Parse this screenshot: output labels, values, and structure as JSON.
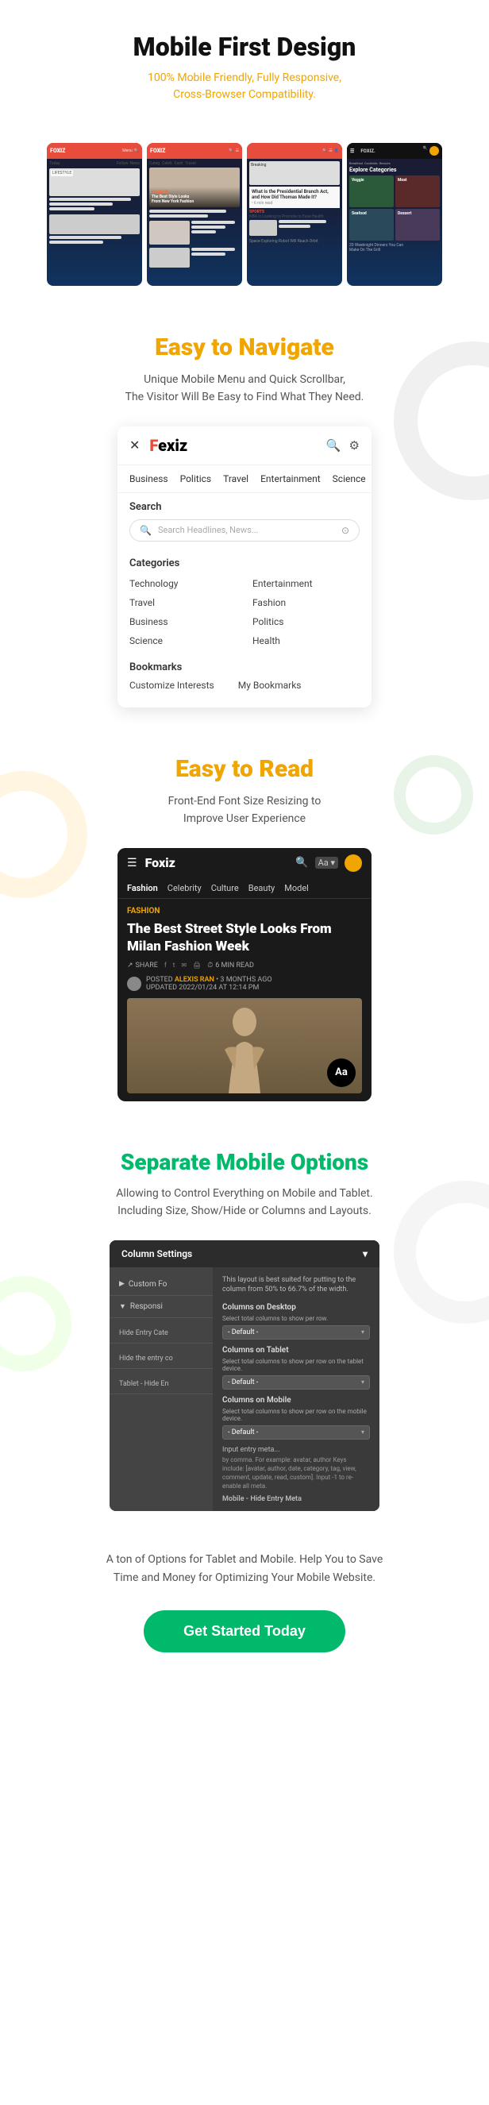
{
  "section1": {
    "title": "Mobile First Design",
    "subtitle": "100% Mobile Friendly, Fully Responsive,\nCross-Browser Compatibility."
  },
  "section2": {
    "title": "Easy to Navigate",
    "description": "Unique Mobile Menu and Quick Scrollbar,\nThe Visitor Will Be Easy to Find What They Need.",
    "menu": {
      "logo": "F",
      "logoRest": "exiz",
      "categories": [
        "Business",
        "Politics",
        "Travel",
        "Entertainment",
        "Science"
      ],
      "search_label": "Search",
      "search_placeholder": "Search Headlines, News...",
      "categories_label": "Categories",
      "cat_items": [
        {
          "col1": "Technology",
          "col2": "Entertainment"
        },
        {
          "col1": "Travel",
          "col2": "Fashion"
        },
        {
          "col1": "Business",
          "col2": "Politics"
        },
        {
          "col1": "Science",
          "col2": "Health"
        }
      ],
      "bookmarks_label": "Bookmarks",
      "bookmark_items": [
        "Customize Interests",
        "My Bookmarks"
      ]
    }
  },
  "section3": {
    "title": "Easy to Read",
    "description": "Front-End Font Size Resizing to\nImprove User Experience",
    "article": {
      "logo": "Foxiz",
      "nav_items": [
        "Fashion",
        "Celebrity",
        "Culture",
        "Beauty",
        "Model"
      ],
      "category": "FASHION",
      "title": "The Best Street Style Looks From Milan Fashion Week",
      "share_label": "SHARE",
      "read_time": "6 MIN READ",
      "posted_label": "POSTED",
      "author": "ALEXIS RAN",
      "time_ago": "3 MONTHS AGO",
      "updated_label": "UPDATED",
      "updated_date": "2022/01/24 AT 12:14 PM",
      "font_size_label": "Aa"
    }
  },
  "section4": {
    "title": "Separate Mobile Options",
    "description": "Allowing to Control Everything on Mobile and Tablet.\nIncluding Size, Show/Hide or Columns and Layouts.",
    "panel": {
      "title": "Column Settings",
      "custom_label": "Custom Fo",
      "responsive_label": "Responsi",
      "desc_text": "This layout is best suited for putting to the column from 50% to 66.7% of the width.",
      "hide_entry_label": "Hide Entry Cate",
      "hide_entry_label2": "Hide the entry co",
      "tablet_hide_label": "Tablet - Hide En",
      "columns_desktop_label": "Columns on Desktop",
      "columns_desktop_desc": "Select total columns to show per row.",
      "columns_desktop_value": "- Default -",
      "columns_tablet_label": "Columns on Tablet",
      "columns_tablet_desc": "Select total columns to show per row on the tablet device.",
      "columns_tablet_value": "- Default -",
      "columns_mobile_label": "Columns on Mobile",
      "columns_mobile_desc": "Select total columns to show per row on the mobile device.",
      "columns_mobile_value": "- Default -",
      "input_entry_text": "Input entry meta...",
      "bottom_text": "by comma. For example: avatar, author Keys include: [avatar, author, date, category, tag, view, comment, update, read, custom]. Input -1 to re-enable all meta.",
      "mobile_hide_label": "Mobile - Hide Entry Meta"
    }
  },
  "section_cta": {
    "description": "A ton of Options for Tablet and Mobile. Help You to Save\nTime and Money for Optimizing Your Mobile Website.",
    "button_label": "Get Started Today"
  }
}
